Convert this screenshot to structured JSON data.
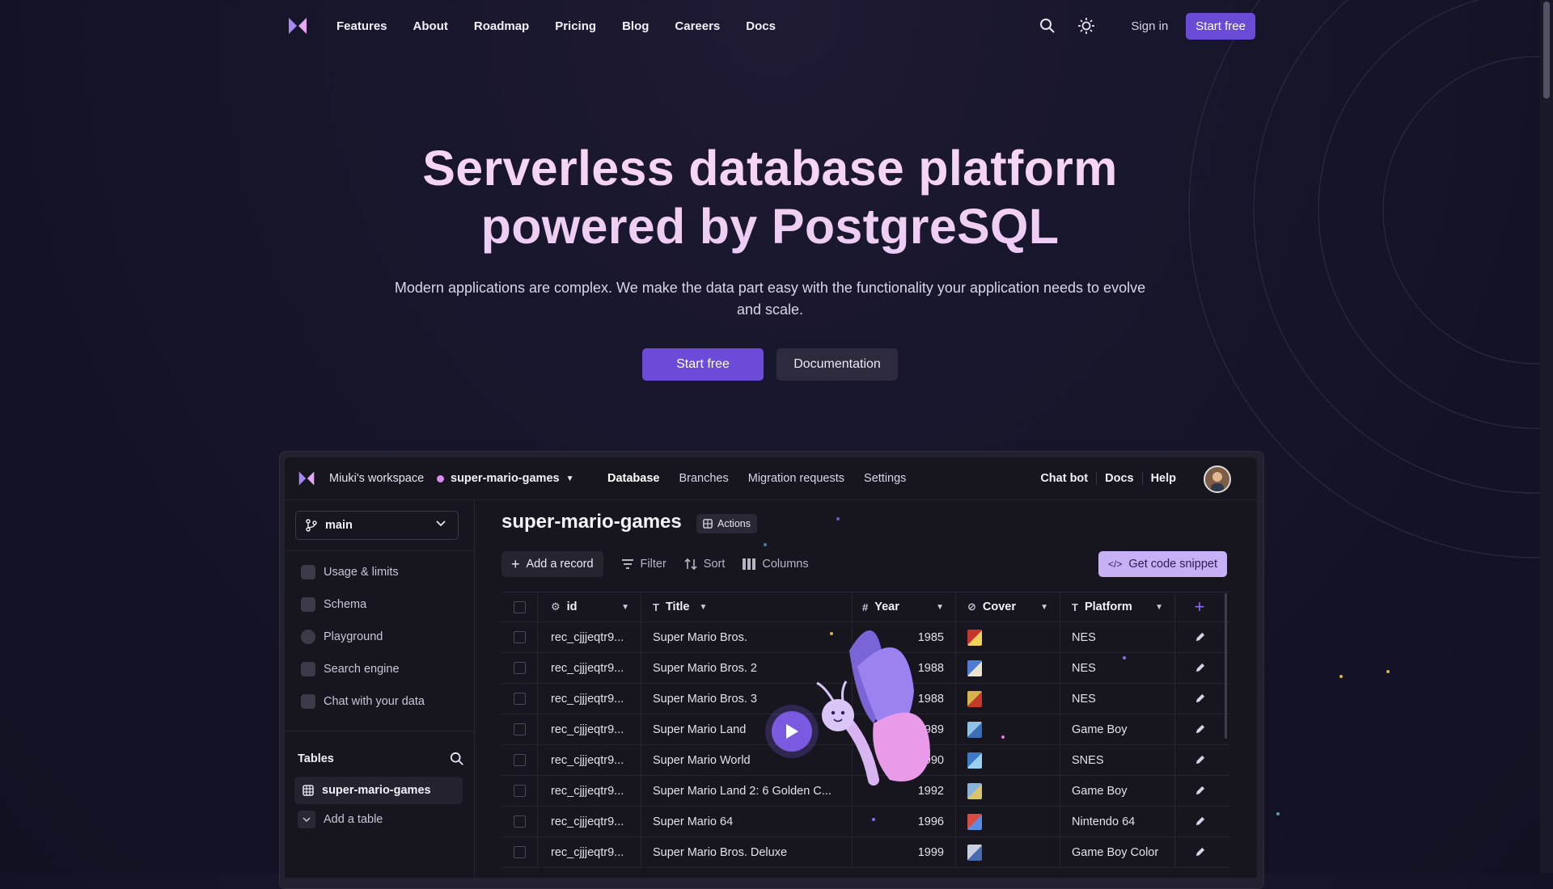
{
  "nav": {
    "links": [
      "Features",
      "About",
      "Roadmap",
      "Pricing",
      "Blog",
      "Careers",
      "Docs"
    ],
    "signin": "Sign in",
    "start": "Start free"
  },
  "hero": {
    "title_line1": "Serverless database platform",
    "title_line2": "powered by PostgreSQL",
    "subtitle": "Modern applications are complex. We make the data part easy with the functionality your application needs to evolve and scale.",
    "primary": "Start free",
    "secondary": "Documentation"
  },
  "app": {
    "workspace": "Miuki's workspace",
    "database": "super-mario-games",
    "tabs": [
      "Database",
      "Branches",
      "Migration requests",
      "Settings"
    ],
    "right": [
      "Chat bot",
      "Docs",
      "Help"
    ],
    "branch": "main",
    "sidebar": [
      "Usage & limits",
      "Schema",
      "Playground",
      "Search engine",
      "Chat with your data"
    ],
    "tables_heading": "Tables",
    "table_name": "super-mario-games",
    "add_table": "Add a table",
    "title": "super-mario-games",
    "actions": "Actions",
    "toolbar": {
      "add": "Add a record",
      "filter": "Filter",
      "sort": "Sort",
      "columns": "Columns",
      "snippet": "Get code snippet"
    },
    "columns": [
      "id",
      "Title",
      "Year",
      "Cover",
      "Platform"
    ],
    "rows": [
      {
        "id": "rec_cjjjeqtr9...",
        "title": "Super Mario Bros.",
        "year": "1985",
        "platform": "NES"
      },
      {
        "id": "rec_cjjjeqtr9...",
        "title": "Super Mario Bros. 2",
        "year": "1988",
        "platform": "NES"
      },
      {
        "id": "rec_cjjjeqtr9...",
        "title": "Super Mario Bros. 3",
        "year": "1988",
        "platform": "NES"
      },
      {
        "id": "rec_cjjjeqtr9...",
        "title": "Super Mario Land",
        "year": "1989",
        "platform": "Game Boy"
      },
      {
        "id": "rec_cjjjeqtr9...",
        "title": "Super Mario World",
        "year": "1990",
        "platform": "SNES"
      },
      {
        "id": "rec_cjjjeqtr9...",
        "title": "Super Mario Land 2: 6 Golden C...",
        "year": "1992",
        "platform": "Game Boy"
      },
      {
        "id": "rec_cjjjeqtr9...",
        "title": "Super Mario 64",
        "year": "1996",
        "platform": "Nintendo 64"
      },
      {
        "id": "rec_cjjjeqtr9...",
        "title": "Super Mario Bros. Deluxe",
        "year": "1999",
        "platform": "Game Boy Color"
      }
    ]
  },
  "colors": {
    "accent": "#6a4bd6",
    "snippet": "#c7b0f3",
    "title": "#f5d6f0"
  }
}
